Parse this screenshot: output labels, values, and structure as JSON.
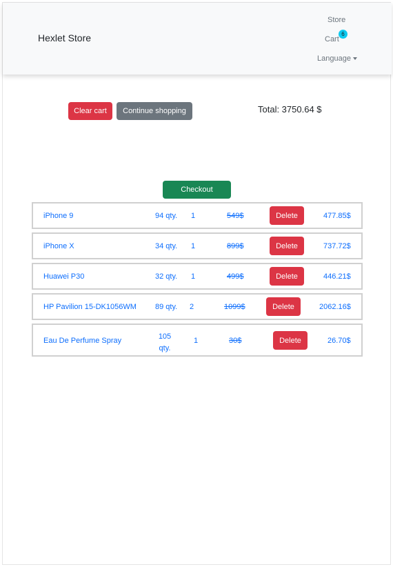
{
  "navbar": {
    "brand": "Hexlet Store",
    "store_link": "Store",
    "cart_link": "Cart",
    "cart_count": "6",
    "language_label": "Language"
  },
  "actions": {
    "clear_cart": "Clear cart",
    "continue_shopping": "Continue shopping",
    "total": "Total: 3750.64 $",
    "checkout": "Checkout",
    "delete_label": "Delete"
  },
  "cart_items": [
    {
      "name": "iPhone 9",
      "stock": "94 qty.",
      "quantity": "1",
      "old_price": "549$",
      "price": "477.85$"
    },
    {
      "name": "iPhone X",
      "stock": "34 qty.",
      "quantity": "1",
      "old_price": "899$",
      "price": "737.72$"
    },
    {
      "name": "Huawei P30",
      "stock": "32 qty.",
      "quantity": "1",
      "old_price": "499$",
      "price": "446.21$"
    },
    {
      "name": "HP Pavilion 15-DK1056WM",
      "stock": "89 qty.",
      "quantity": "2",
      "old_price": "1099$",
      "price": "2062.16$"
    },
    {
      "name": "Eau De Perfume Spray",
      "stock": "105 qty.",
      "quantity": "1",
      "old_price": "30$",
      "price": "26.70$"
    }
  ],
  "colors": {
    "danger": "#dc3545",
    "secondary": "#6c757d",
    "success": "#198754",
    "link": "#0d6efd",
    "badge": "#0dcaf0"
  }
}
